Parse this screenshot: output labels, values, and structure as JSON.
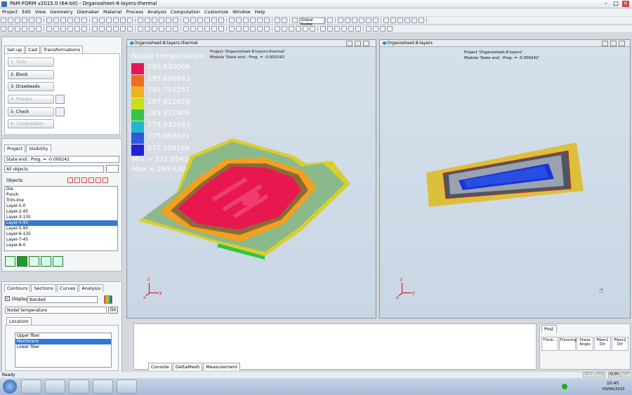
{
  "window": {
    "title": "PAM-FORM v2015.0 (64-bit) - Organosheet-8-layers-thermal"
  },
  "menu": [
    "Project",
    "Edit",
    "View",
    "Geometry",
    "Diemaker",
    "Material",
    "Process",
    "Analysis",
    "Computation",
    "Customize",
    "Window",
    "Help"
  ],
  "toolbar": {
    "coord_system": "Global Syster"
  },
  "setup_tabs": [
    "Set-up",
    "Cad",
    "Transformations"
  ],
  "steps": [
    {
      "num": "1-",
      "label": "Tools"
    },
    {
      "num": "2-",
      "label": "Blank"
    },
    {
      "num": "3-",
      "label": "Drawbeads"
    },
    {
      "num": "4-",
      "label": "Process"
    },
    {
      "num": "5-",
      "label": "Check"
    },
    {
      "num": "6-",
      "label": "Computation"
    }
  ],
  "project_tabs": [
    "Project",
    "Visibility"
  ],
  "state_select": "State end : Prog. = -0.000242",
  "objects_select": "All objects",
  "objects_label": "Objects:",
  "objects": [
    "Die",
    "Punch",
    "Trim-line",
    "Layer-1-0",
    "Layer-2-45",
    "Layer-3-135",
    "Layer-4-90",
    "Layer-5-90",
    "Layer-6-135",
    "Layer-7-45",
    "Layer-8-0"
  ],
  "objects_selected": "Layer-4-90",
  "contour_tabs": [
    "Contours",
    "Sections",
    "Curves",
    "Analysis"
  ],
  "display_label": "Display",
  "display_mode": "Banded",
  "contour_variable": "Nodal temperature",
  "go_label": "Go",
  "location_tab": "Location",
  "locations": [
    "Upper fiber",
    "Membrane",
    "Lower fiber"
  ],
  "locations_selected": "Membrane",
  "viewport_left": {
    "title": "Organosheet-8-layers-thermal",
    "project_line": "Project 'Organosheet-8-layers-thermal'",
    "module_line": "Module 'State end : Prog. = -0.000242'"
  },
  "viewport_right": {
    "title": "Organosheet-8-layers",
    "project_line": "Project 'Organosheet-8-layers'",
    "module_line": "Module 'State end : Prog. = -0.000242'"
  },
  "legend": {
    "title": "Nodal temperature",
    "values": [
      "299.630066",
      "295.690643",
      "291.751251",
      "287.811829",
      "283.872406",
      "279.932983",
      "275.993591",
      "272.054169"
    ],
    "colors": [
      "#e8134f",
      "#f06b1a",
      "#f3b11c",
      "#c8e01a",
      "#33c443",
      "#21b6cf",
      "#2b57d9",
      "#1f1fd0"
    ],
    "min_label": "Min = ",
    "min_value": "272.054169",
    "max_label": "Max = ",
    "max_value": "299.630066"
  },
  "axes": {
    "x": "x",
    "y": "y",
    "z": "z"
  },
  "console_tabs": [
    "Console",
    "DeltaMesh",
    "Measurement"
  ],
  "post": {
    "title": "Post",
    "buttons": [
      "Thick...",
      "Thinning",
      "Shear Angle",
      "Fiber1 Dir",
      "Fiber2 Dir"
    ]
  },
  "status": {
    "left": "Ready",
    "indicators": [
      "ADV",
      "MAJ",
      "NUM",
      "DEF"
    ]
  },
  "clock": {
    "time": "10:45",
    "date": "09/06/2015"
  }
}
